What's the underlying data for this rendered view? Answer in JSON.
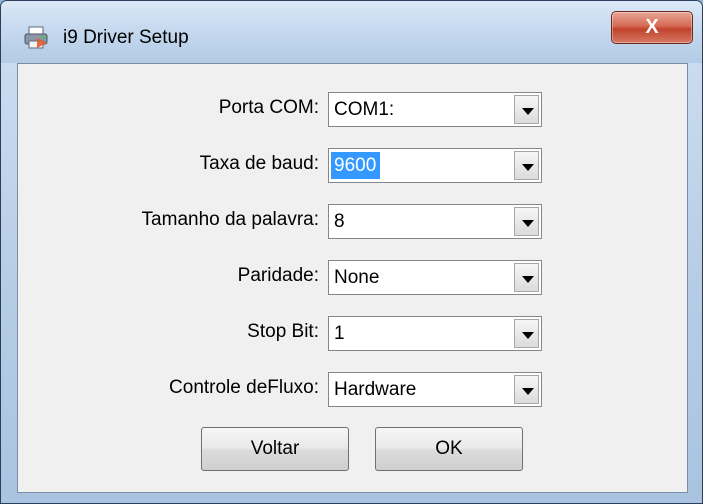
{
  "window": {
    "title": "i9 Driver Setup",
    "close_label": "X"
  },
  "form": {
    "fields": [
      {
        "label": "Porta COM:",
        "value": "COM1:"
      },
      {
        "label": "Taxa de baud:",
        "value": "9600"
      },
      {
        "label": "Tamanho da palavra:",
        "value": "8"
      },
      {
        "label": "Paridade:",
        "value": "None"
      },
      {
        "label": "Stop Bit:",
        "value": "1"
      },
      {
        "label": "Controle deFluxo:",
        "value": "Hardware"
      }
    ]
  },
  "buttons": {
    "back_label": "Voltar",
    "ok_label": "OK"
  },
  "colors": {
    "selection": "#3399ff",
    "close_button": "#c0432c"
  }
}
